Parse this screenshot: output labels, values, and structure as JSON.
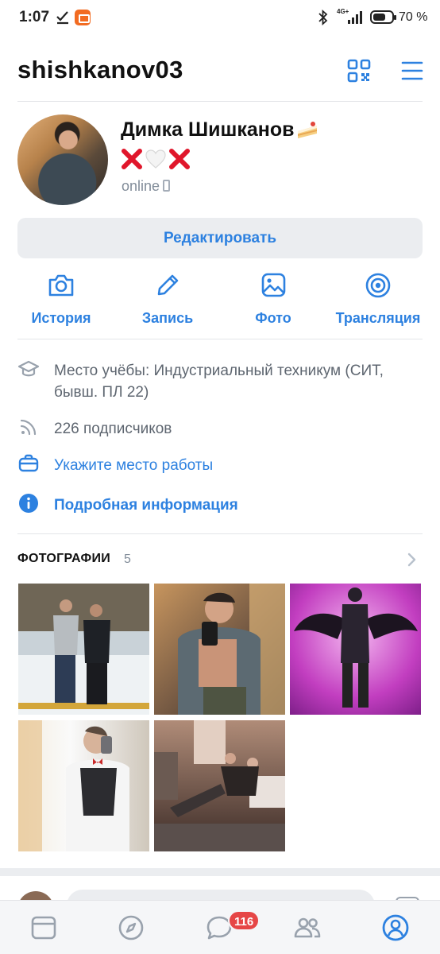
{
  "status_bar": {
    "time": "1:07",
    "network": "4G+",
    "battery_pct": "70 %",
    "battery_level": 0.7
  },
  "header": {
    "username": "shishkanov03",
    "qr_icon": "qr-code-icon",
    "menu_icon": "hamburger-menu-icon"
  },
  "profile": {
    "name": "Димка Шишканов",
    "name_emoji": "cake-icon",
    "status_emojis": [
      "cross-mark-icon",
      "white-heart-icon",
      "cross-mark-icon"
    ],
    "presence": "online",
    "edit_label": "Редактировать"
  },
  "actions": [
    {
      "label": "История",
      "icon": "camera-icon"
    },
    {
      "label": "Запись",
      "icon": "pencil-icon"
    },
    {
      "label": "Фото",
      "icon": "image-icon"
    },
    {
      "label": "Трансляция",
      "icon": "broadcast-icon"
    }
  ],
  "info": {
    "education": "Место учёбы: Индустриальный техникум (СИТ, бывш. ПЛ 22)",
    "followers": "226 подписчиков",
    "work": "Укажите место работы",
    "details": "Подробная информация"
  },
  "photos": {
    "title": "ФОТОГРАФИИ",
    "count": "5"
  },
  "tabbar": {
    "tabs": [
      "feed-icon",
      "explore-compass-icon",
      "messages-icon",
      "friends-icon",
      "profile-icon"
    ],
    "messages_badge": "116"
  },
  "colors": {
    "accent": "#2d81e0",
    "secondary_text": "#818c99",
    "button_bg": "#ebedf0",
    "badge": "#e64646"
  }
}
